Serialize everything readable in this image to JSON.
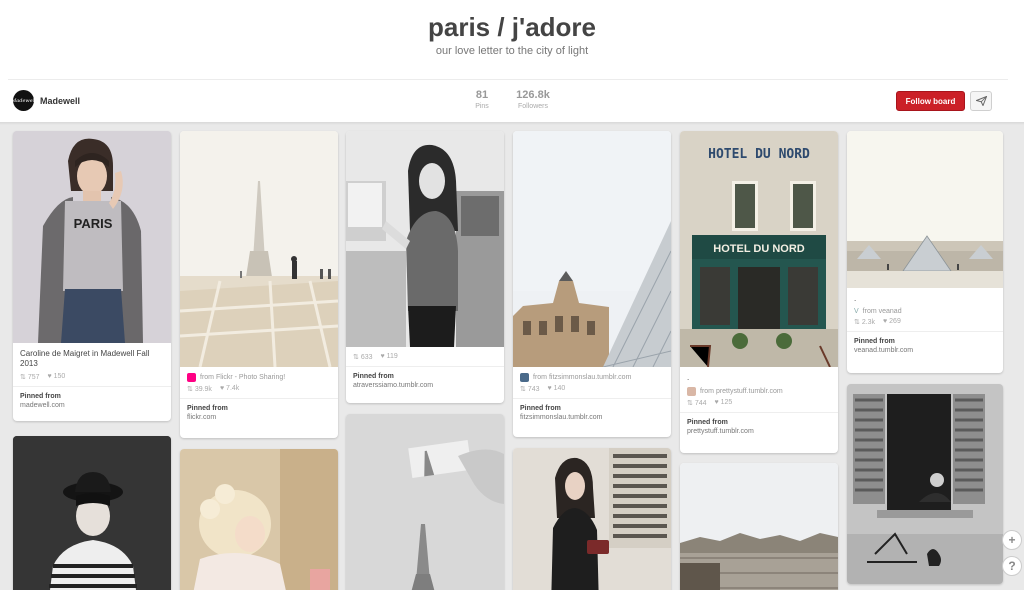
{
  "board": {
    "title": "paris / j'adore",
    "description": "our love letter to the city of light",
    "owner": "Madewell",
    "owner_avatar_text": "Madewell",
    "pins_count": "81",
    "pins_label": "Pins",
    "followers_count": "126.8k",
    "followers_label": "Followers",
    "follow_label": "Follow board",
    "send_icon": "paper-plane-icon"
  },
  "pins": [
    {
      "description": "Caroline de Maigret in Madewell Fall 2013",
      "source": "",
      "repins": "757",
      "likes": "150",
      "pinned_label": "Pinned from",
      "domain": "madewell.com"
    },
    {
      "description": "",
      "source": "from Flickr - Photo Sharing!",
      "repins": "39.9k",
      "likes": "7.4k",
      "pinned_label": "Pinned from",
      "domain": "flickr.com"
    },
    {
      "description": "",
      "source": "",
      "repins": "633",
      "likes": "119",
      "pinned_label": "Pinned from",
      "domain": "atraverssiamo.tumblr.com"
    },
    {
      "description": "",
      "source": "from fitzsimmonslau.tumblr.com",
      "repins": "743",
      "likes": "140",
      "pinned_label": "Pinned from",
      "domain": "fitzsimmonslau.tumblr.com"
    },
    {
      "description": ".",
      "source": "from prettystuff.tumblr.com",
      "repins": "744",
      "likes": "125",
      "pinned_label": "Pinned from",
      "domain": "prettystuff.tumblr.com",
      "sign_top": "HOTEL DU NORD",
      "sign_bottom": "HOTEL DU NORD"
    },
    {
      "description": ".",
      "source": "from veanad",
      "repins": "2.3k",
      "likes": "269",
      "pinned_label": "Pinned from",
      "domain": "veanad.tumblr.com"
    }
  ],
  "side": {
    "add_symbol": "+",
    "help_symbol": "?"
  },
  "colors": {
    "brand_red": "#cb2027",
    "background": "#e9e9e9"
  }
}
